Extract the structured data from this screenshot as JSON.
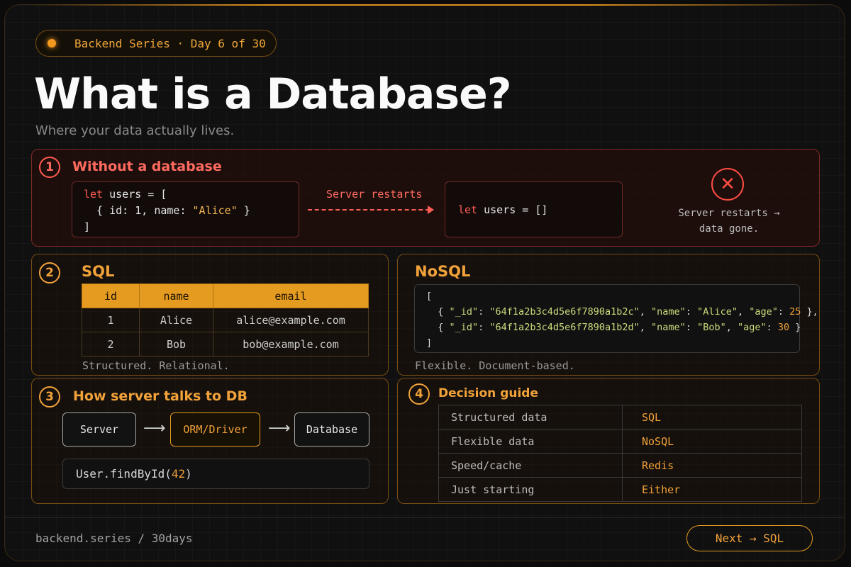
{
  "badge": {
    "text": "Backend Series · Day 6 of 30"
  },
  "header": {
    "title": "What is a Database?",
    "subtitle": "Where your data actually lives."
  },
  "section1": {
    "number": "1",
    "title": "Without a database",
    "code_before": {
      "l1_kw": "let",
      "l1_rest": " users = [",
      "l2_a": "  { id: 1, name: ",
      "l2_str": "\"Alice\"",
      "l2_b": " }",
      "l3": "]"
    },
    "arrow_label": "Server restarts",
    "code_after": {
      "kw": "let",
      "rest": " users = []"
    },
    "icon": "x-circle-icon",
    "note": "Server restarts → data gone."
  },
  "section2": {
    "number": "2",
    "sql": {
      "title": "SQL",
      "columns": [
        "id",
        "name",
        "email"
      ],
      "rows": [
        [
          "1",
          "Alice",
          "alice@example.com"
        ],
        [
          "2",
          "Bob",
          "bob@example.com"
        ]
      ],
      "caption": "Structured. Relational."
    },
    "nosql": {
      "title": "NoSQL",
      "docs": [
        {
          "id": "\"64f1a2b3c4d5e6f7890a1b2c\"",
          "name": "\"Alice\"",
          "age": "25"
        },
        {
          "id": "\"64f1a2b3c4d5e6f7890a1b2d\"",
          "name": "\"Bob\"",
          "age": "30"
        }
      ],
      "caption": "Flexible. Document-based."
    }
  },
  "section3": {
    "number": "3",
    "title": "How server talks to DB",
    "flow": [
      "Server",
      "ORM/Driver",
      "Database"
    ],
    "arrow": "⟶",
    "code": {
      "fn": "User.findById(",
      "arg": "42",
      "end": ")"
    }
  },
  "section4": {
    "number": "4",
    "title": "Decision guide",
    "rows": [
      {
        "k": "Structured data",
        "v": "SQL"
      },
      {
        "k": "Flexible data",
        "v": "NoSQL"
      },
      {
        "k": "Speed/cache",
        "v": "Redis"
      },
      {
        "k": "Just starting",
        "v": "Either"
      }
    ]
  },
  "footer": {
    "left": "backend.series / 30days",
    "next": "Next → SQL"
  },
  "colors": {
    "accent": "#e59b1f",
    "danger": "#ff5e54",
    "bg": "#0b0b0b"
  }
}
